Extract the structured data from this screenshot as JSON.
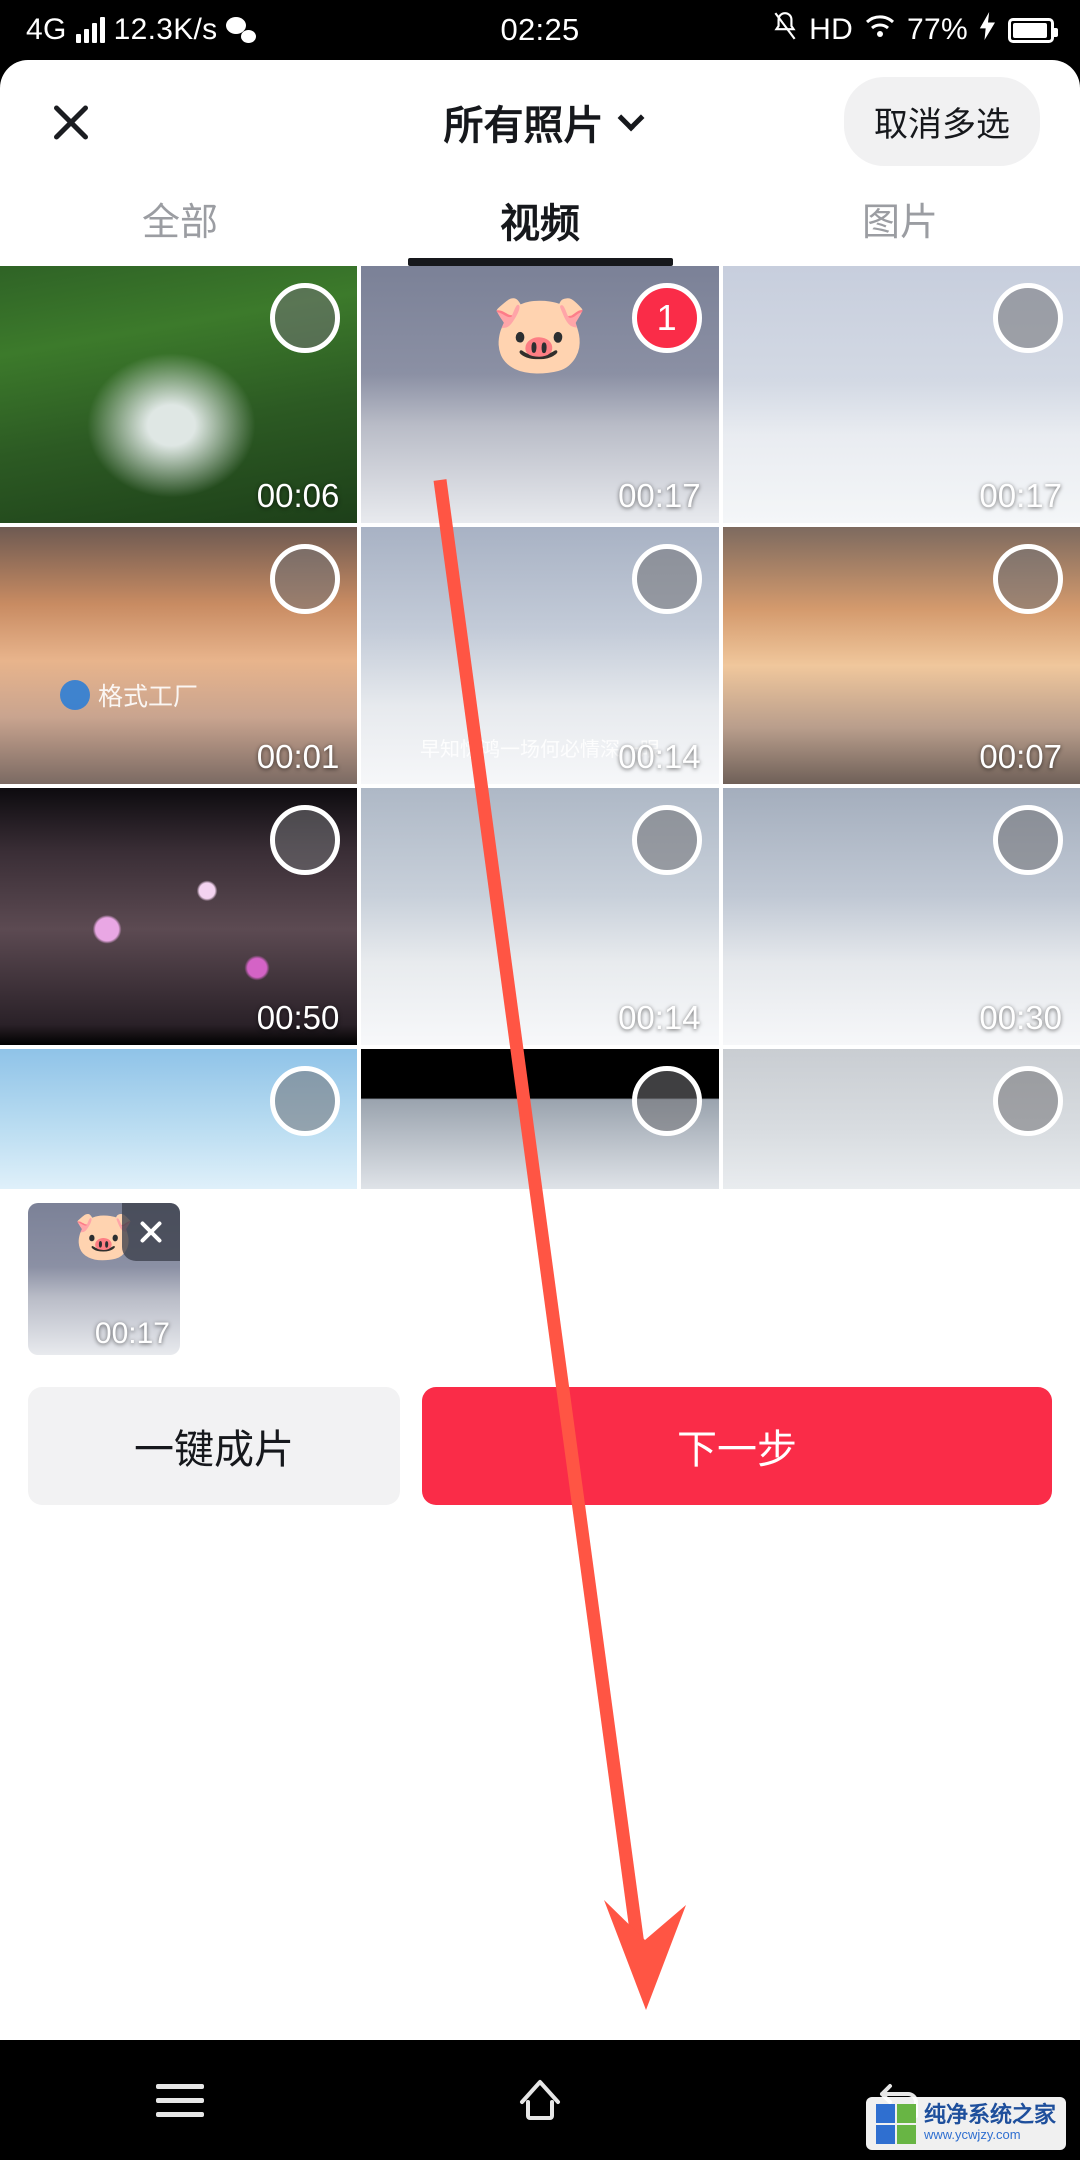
{
  "status_bar": {
    "network_type": "4G",
    "speed": "12.3K/s",
    "time": "02:25",
    "hd_label": "HD",
    "battery_percent": "77%",
    "icons": [
      "signal-bars-icon",
      "wechat-icon",
      "mute-bell-icon",
      "wifi-icon",
      "charging-bolt-icon",
      "battery-icon"
    ]
  },
  "appbar": {
    "close_label": "✕",
    "album_title": "所有照片",
    "cancel_multiselect": "取消多选"
  },
  "tabs": [
    {
      "label": "全部",
      "active": false
    },
    {
      "label": "视频",
      "active": true
    },
    {
      "label": "图片",
      "active": false
    }
  ],
  "grid": {
    "items": [
      {
        "duration": "00:06",
        "selected": false,
        "art": "art-waterfall",
        "sticker": ""
      },
      {
        "duration": "00:17",
        "selected": true,
        "art": "art-snowfence",
        "sticker": "🐷",
        "badge": "1"
      },
      {
        "duration": "00:17",
        "selected": false,
        "art": "art-snowfence2",
        "sticker": ""
      },
      {
        "duration": "00:01",
        "selected": false,
        "art": "art-sunset",
        "sticker": "",
        "watermark": "格式工厂"
      },
      {
        "duration": "00:14",
        "selected": false,
        "art": "art-snowbridge",
        "sticker": "",
        "caption": "早知惊鸿一场何必情深一眼"
      },
      {
        "duration": "00:07",
        "selected": false,
        "art": "art-sunset2",
        "sticker": ""
      },
      {
        "duration": "00:50",
        "selected": false,
        "art": "art-blossom",
        "sticker": ""
      },
      {
        "duration": "00:14",
        "selected": false,
        "art": "art-snowdeck",
        "sticker": ""
      },
      {
        "duration": "00:30",
        "selected": false,
        "art": "art-snowdeck2",
        "sticker": ""
      },
      {
        "duration": "",
        "selected": false,
        "art": "art-birds",
        "sticker": ""
      },
      {
        "duration": "",
        "selected": false,
        "art": "art-dark",
        "sticker": ""
      },
      {
        "duration": "",
        "selected": false,
        "art": "art-fog",
        "sticker": ""
      }
    ]
  },
  "selected_strip": {
    "items": [
      {
        "duration": "00:17",
        "sticker": "🐷",
        "remove_label": "✕"
      }
    ]
  },
  "actions": {
    "secondary_label": "一键成片",
    "primary_label": "下一步"
  },
  "navbar": {
    "menu_icon": "menu-icon",
    "home_icon": "home-icon",
    "back_icon": "back-icon"
  },
  "watermark": {
    "title": "纯净系统之家",
    "url": "www.ycwjzy.com"
  },
  "colors": {
    "accent": "#fa2c48",
    "annotation_arrow": "#ff5544",
    "text_primary": "#16181c",
    "text_muted": "#9b9da2"
  }
}
